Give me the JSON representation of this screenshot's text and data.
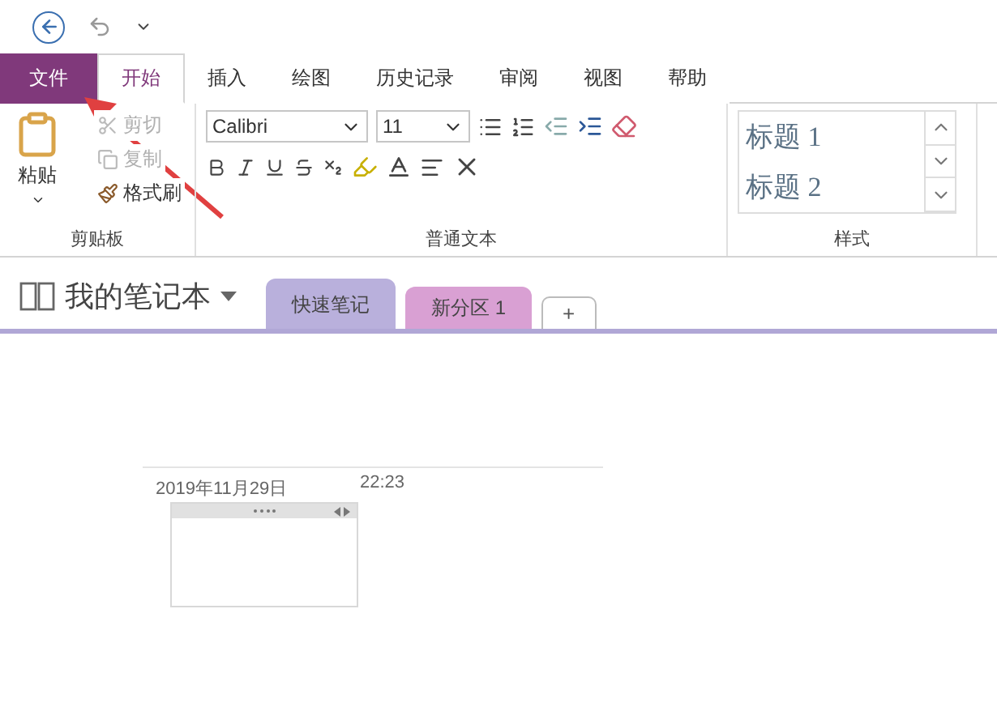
{
  "ribbon_tabs": [
    {
      "label": "文件",
      "kind": "file",
      "selected": false
    },
    {
      "label": "开始",
      "kind": "tab",
      "selected": true
    },
    {
      "label": "插入",
      "kind": "tab",
      "selected": false
    },
    {
      "label": "绘图",
      "kind": "tab",
      "selected": false
    },
    {
      "label": "历史记录",
      "kind": "tab",
      "selected": false
    },
    {
      "label": "审阅",
      "kind": "tab",
      "selected": false
    },
    {
      "label": "视图",
      "kind": "tab",
      "selected": false
    },
    {
      "label": "帮助",
      "kind": "tab",
      "selected": false
    }
  ],
  "clipboard": {
    "paste": "粘贴",
    "items": [
      {
        "label": "剪切",
        "kind": "cut",
        "disabled": true
      },
      {
        "label": "复制",
        "kind": "copy",
        "disabled": true
      },
      {
        "label": "格式刷",
        "kind": "painter",
        "disabled": false
      }
    ],
    "group_label": "剪贴板"
  },
  "basic_text": {
    "font": "Calibri",
    "size": "11",
    "group_label": "普通文本"
  },
  "styles": {
    "items": [
      {
        "label": "标题 1"
      },
      {
        "label": "标题 2"
      }
    ],
    "group_label": "样式"
  },
  "notebook": {
    "name": "我的笔记本",
    "sections": [
      {
        "label": "快速笔记",
        "color": "#b9b0dc",
        "selected": true
      },
      {
        "label": "新分区 1",
        "color": "#d9a0d3",
        "selected": false
      }
    ],
    "add_tab": "+"
  },
  "page": {
    "date": "2019年11月29日",
    "time": "22:23"
  }
}
